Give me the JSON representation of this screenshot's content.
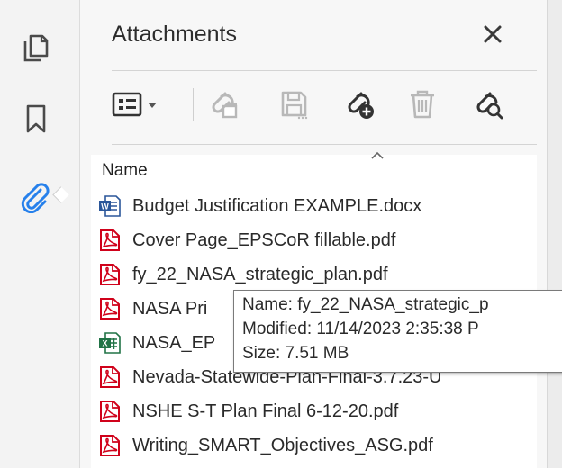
{
  "panel": {
    "title": "Attachments",
    "column_header": "Name"
  },
  "icons": {
    "rail": [
      "pages-icon",
      "bookmark-icon",
      "paperclip-icon"
    ],
    "toolbar": [
      "options-menu-icon",
      "open-attachment-icon",
      "save-attachment-icon",
      "add-attachment-icon",
      "delete-icon",
      "search-attachment-icon"
    ],
    "accent": "#2680eb",
    "pdf_red": "#d0021b",
    "word_blue": "#2b579a",
    "excel_green": "#217346"
  },
  "files": [
    {
      "name": "Budget Justification EXAMPLE.docx",
      "type": "word"
    },
    {
      "name": "Cover Page_EPSCoR fillable.pdf",
      "type": "pdf"
    },
    {
      "name": "fy_22_NASA_strategic_plan.pdf",
      "type": "pdf"
    },
    {
      "name": "NASA Pri",
      "type": "pdf"
    },
    {
      "name": "NASA_EP",
      "type": "excel"
    },
    {
      "name": "Nevada-Statewide-Plan-Final-3.7.23-U",
      "type": "pdf"
    },
    {
      "name": "NSHE S-T Plan Final 6-12-20.pdf",
      "type": "pdf"
    },
    {
      "name": "Writing_SMART_Objectives_ASG.pdf",
      "type": "pdf"
    }
  ],
  "tooltip": {
    "name": "Name: fy_22_NASA_strategic_p",
    "modified": "Modified: 11/14/2023 2:35:38 P",
    "size": "Size: 7.51 MB"
  }
}
